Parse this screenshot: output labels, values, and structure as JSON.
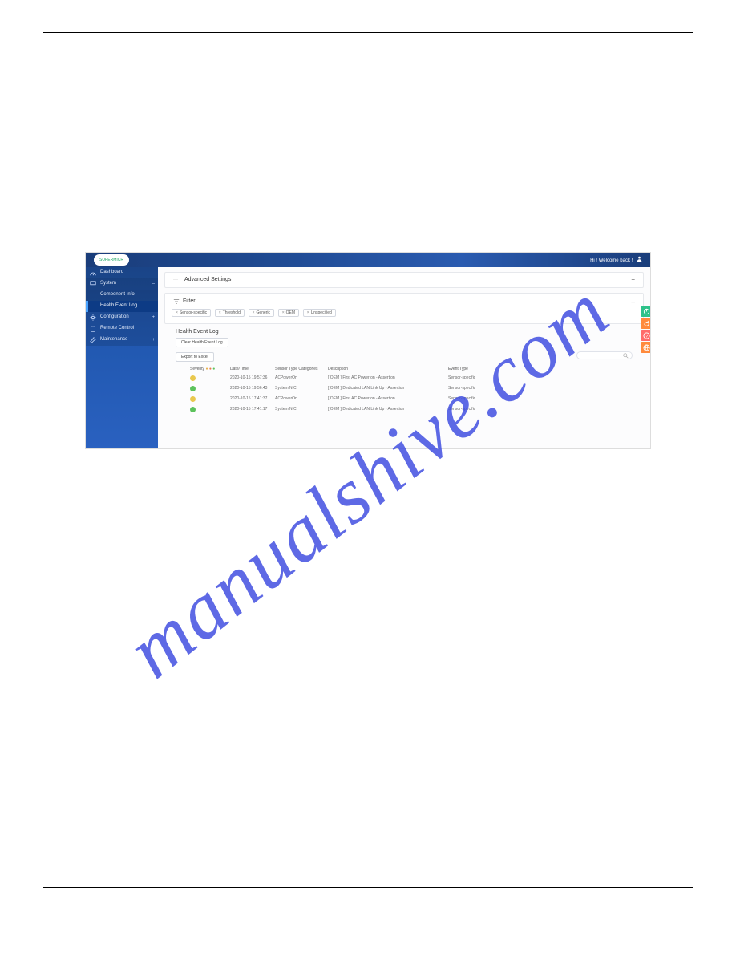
{
  "watermark": "manualshive.com",
  "topbar": {
    "logo_text": "SUPERMICR",
    "welcome": "Hi ! Welcome back !"
  },
  "sidebar": {
    "items": [
      {
        "label": "Dashboard",
        "type": "top"
      },
      {
        "label": "System",
        "type": "top-open"
      },
      {
        "label": "Component Info",
        "type": "sub"
      },
      {
        "label": "Health Event Log",
        "type": "selected"
      },
      {
        "label": "Configuration",
        "type": "top-exp"
      },
      {
        "label": "Remote Control",
        "type": "top"
      },
      {
        "label": "Maintenance",
        "type": "top-exp"
      }
    ]
  },
  "panels": {
    "advanced": {
      "label": "Advanced Settings",
      "toggle": "+"
    },
    "filter": {
      "label": "Filter",
      "toggle": "–",
      "chips": [
        "Sensor-specific",
        "Threshold",
        "Generic",
        "OEM",
        "Unspecified"
      ]
    }
  },
  "log": {
    "title": "Health Event Log",
    "clear_btn": "Clear Health Event Log",
    "export_btn": "Export to Excel",
    "headers": {
      "severity": "Severity",
      "date": "Date/Time",
      "sensor": "Sensor Type Categories",
      "desc": "Description",
      "event": "Event Type"
    },
    "rows": [
      {
        "sev": "y",
        "date": "2020-10-15 19:57:36",
        "sensor": "ACPowerOn",
        "desc": "[ OEM ] First AC Power on - Assertion",
        "event": "Sensor-specific"
      },
      {
        "sev": "g",
        "date": "2020-10-15 19:56:43",
        "sensor": "System NIC",
        "desc": "[ OEM ] Dedicated LAN Link Up - Assertion",
        "event": "Sensor-specific"
      },
      {
        "sev": "y",
        "date": "2020-10-15 17:41:37",
        "sensor": "ACPowerOn",
        "desc": "[ OEM ] First AC Power on - Assertion",
        "event": "Sensor-specific"
      },
      {
        "sev": "g",
        "date": "2020-10-15 17:41:17",
        "sensor": "System NIC",
        "desc": "[ OEM ] Dedicated LAN Link Up - Assertion",
        "event": "Sensor-specific"
      }
    ]
  }
}
